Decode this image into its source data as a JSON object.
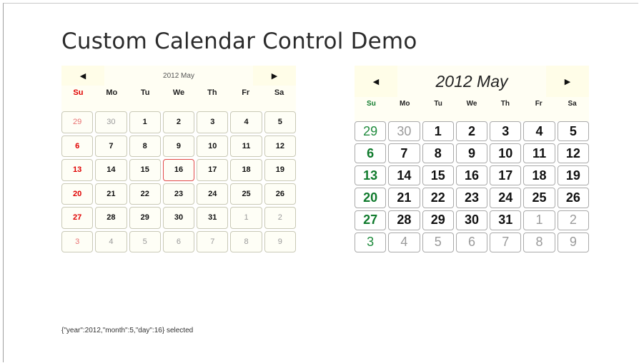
{
  "page": {
    "title": "Custom Calendar Control Demo",
    "status": "{\"year\":2012,\"month\":5,\"day\":16} selected"
  },
  "colors": {
    "sunday_small": "#e00000",
    "sunday_large": "#0f7a2c",
    "selected_border": "#e24a4a",
    "header_bg": "#fffde8"
  },
  "calendars": [
    {
      "id": "cal-small",
      "month_label": "2012 May",
      "prev_icon": "◀",
      "next_icon": "▶",
      "weekdays": [
        "Su",
        "Mo",
        "Tu",
        "We",
        "Th",
        "Fr",
        "Sa"
      ],
      "selected_day": 16,
      "weeks": [
        [
          {
            "d": "29",
            "o": true
          },
          {
            "d": "30",
            "o": true
          },
          {
            "d": "1"
          },
          {
            "d": "2"
          },
          {
            "d": "3"
          },
          {
            "d": "4"
          },
          {
            "d": "5"
          }
        ],
        [
          {
            "d": "6"
          },
          {
            "d": "7"
          },
          {
            "d": "8"
          },
          {
            "d": "9"
          },
          {
            "d": "10"
          },
          {
            "d": "11"
          },
          {
            "d": "12"
          }
        ],
        [
          {
            "d": "13"
          },
          {
            "d": "14"
          },
          {
            "d": "15"
          },
          {
            "d": "16",
            "s": true
          },
          {
            "d": "17"
          },
          {
            "d": "18"
          },
          {
            "d": "19"
          }
        ],
        [
          {
            "d": "20"
          },
          {
            "d": "21"
          },
          {
            "d": "22"
          },
          {
            "d": "23"
          },
          {
            "d": "24"
          },
          {
            "d": "25"
          },
          {
            "d": "26"
          }
        ],
        [
          {
            "d": "27"
          },
          {
            "d": "28"
          },
          {
            "d": "29"
          },
          {
            "d": "30"
          },
          {
            "d": "31"
          },
          {
            "d": "1",
            "o": true
          },
          {
            "d": "2",
            "o": true
          }
        ],
        [
          {
            "d": "3",
            "o": true
          },
          {
            "d": "4",
            "o": true
          },
          {
            "d": "5",
            "o": true
          },
          {
            "d": "6",
            "o": true
          },
          {
            "d": "7",
            "o": true
          },
          {
            "d": "8",
            "o": true
          },
          {
            "d": "9",
            "o": true
          }
        ]
      ]
    },
    {
      "id": "cal-large",
      "month_label": "2012 May",
      "prev_icon": "◀",
      "next_icon": "▶",
      "weekdays": [
        "Su",
        "Mo",
        "Tu",
        "We",
        "Th",
        "Fr",
        "Sa"
      ],
      "selected_day": 16,
      "weeks": [
        [
          {
            "d": "29",
            "o": true
          },
          {
            "d": "30",
            "o": true
          },
          {
            "d": "1"
          },
          {
            "d": "2"
          },
          {
            "d": "3"
          },
          {
            "d": "4"
          },
          {
            "d": "5"
          }
        ],
        [
          {
            "d": "6"
          },
          {
            "d": "7"
          },
          {
            "d": "8"
          },
          {
            "d": "9"
          },
          {
            "d": "10"
          },
          {
            "d": "11"
          },
          {
            "d": "12"
          }
        ],
        [
          {
            "d": "13"
          },
          {
            "d": "14"
          },
          {
            "d": "15"
          },
          {
            "d": "16",
            "s": true
          },
          {
            "d": "17"
          },
          {
            "d": "18"
          },
          {
            "d": "19"
          }
        ],
        [
          {
            "d": "20"
          },
          {
            "d": "21"
          },
          {
            "d": "22"
          },
          {
            "d": "23"
          },
          {
            "d": "24"
          },
          {
            "d": "25"
          },
          {
            "d": "26"
          }
        ],
        [
          {
            "d": "27"
          },
          {
            "d": "28"
          },
          {
            "d": "29"
          },
          {
            "d": "30"
          },
          {
            "d": "31"
          },
          {
            "d": "1",
            "o": true
          },
          {
            "d": "2",
            "o": true
          }
        ],
        [
          {
            "d": "3",
            "o": true
          },
          {
            "d": "4",
            "o": true
          },
          {
            "d": "5",
            "o": true
          },
          {
            "d": "6",
            "o": true
          },
          {
            "d": "7",
            "o": true
          },
          {
            "d": "8",
            "o": true
          },
          {
            "d": "9",
            "o": true
          }
        ]
      ]
    }
  ]
}
